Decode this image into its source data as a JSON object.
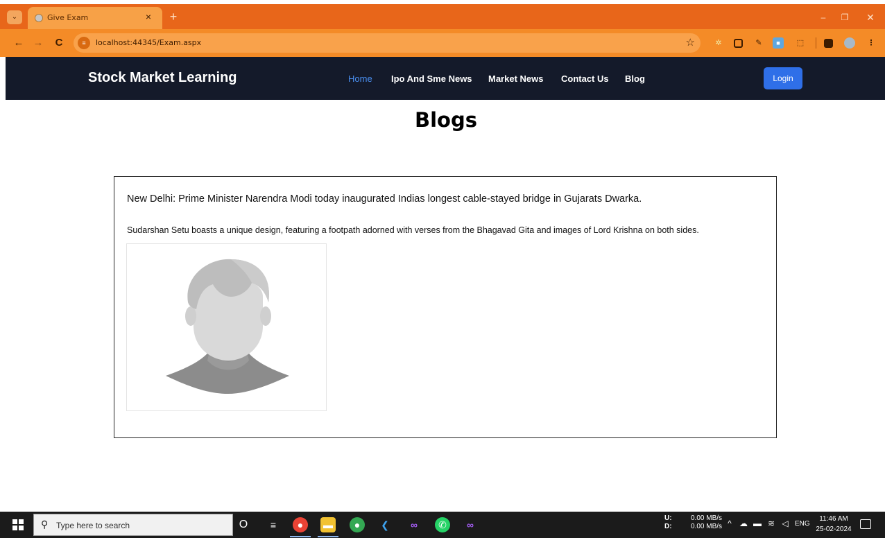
{
  "browser": {
    "tab_title": "Give Exam",
    "tab_close": "×",
    "new_tab": "+",
    "url": "localhost:44345/Exam.aspx",
    "window": {
      "minimize": "–",
      "maximize": "❐",
      "close": "✕"
    }
  },
  "site": {
    "brand": "Stock Market Learning",
    "nav": [
      {
        "label": "Home",
        "active": true
      },
      {
        "label": "Ipo And Sme News"
      },
      {
        "label": "Market News"
      },
      {
        "label": "Contact Us"
      },
      {
        "label": "Blog"
      }
    ],
    "login_label": "Login"
  },
  "page": {
    "title": "Blogs",
    "blog": {
      "headline": "New Delhi: Prime Minister Narendra Modi today inaugurated Indias longest cable-stayed bridge in Gujarats Dwarka.",
      "body": "Sudarshan Setu boasts a unique design, featuring a footpath adorned with verses from the Bhagavad Gita and images of Lord Krishna on both sides.",
      "image_icon": "default-avatar-placeholder"
    }
  },
  "taskbar": {
    "search_placeholder": "Type here to search",
    "net_labels": [
      "U:",
      "D:"
    ],
    "net_speeds": [
      "0.00 MB/s",
      "0.00 MB/s"
    ],
    "language": "ENG",
    "time": "11:46 AM",
    "date": "25-02-2024",
    "pinned_icons": [
      "cortana-icon",
      "task-view-icon",
      "chrome-icon",
      "file-explorer-icon",
      "chrome-profile-icon",
      "vscode-icon",
      "visual-studio-icon",
      "whatsapp-icon",
      "visual-studio-preview-icon"
    ]
  },
  "colors": {
    "browser_tabstrip": "#e8661a",
    "browser_toolbar": "#f48b27",
    "site_nav_bg": "#141a2a",
    "nav_active": "#4a8ff0",
    "login_button": "#2f6fe8",
    "taskbar_bg": "#1b1b1b"
  }
}
